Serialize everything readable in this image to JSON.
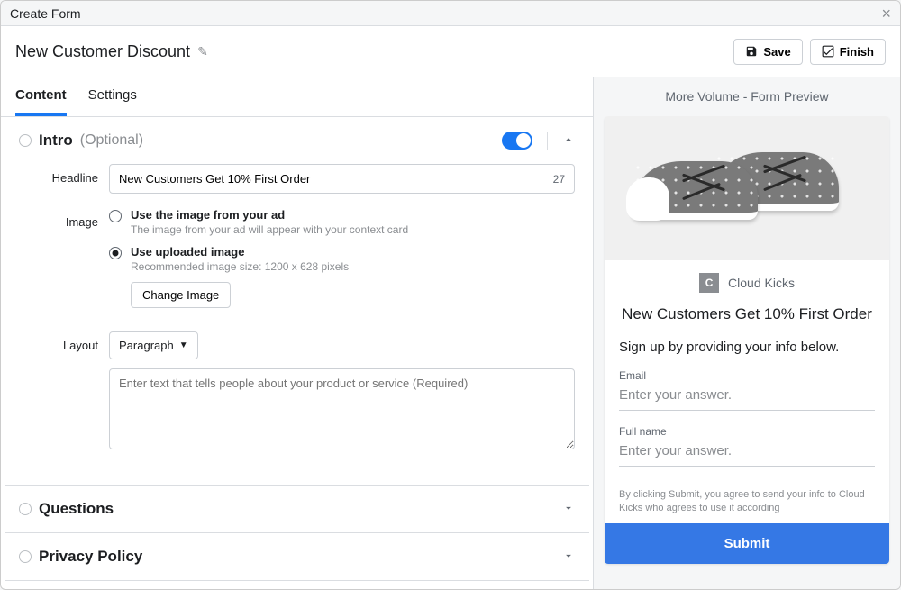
{
  "dialog": {
    "title": "Create Form"
  },
  "form_name": "New Customer Discount",
  "header_buttons": {
    "save": "Save",
    "finish": "Finish"
  },
  "tabs": {
    "content": "Content",
    "settings": "Settings"
  },
  "sections": {
    "intro": {
      "title": "Intro",
      "optional": "(Optional)",
      "toggle_on": true,
      "headline_label": "Headline",
      "headline_value": "New Customers Get 10% First Order",
      "headline_count": "27",
      "image_label": "Image",
      "image_opts": {
        "from_ad": {
          "title": "Use the image from your ad",
          "sub": "The image from your ad will appear with your context card"
        },
        "uploaded": {
          "title": "Use uploaded image",
          "sub": "Recommended image size: 1200 x 628 pixels",
          "button": "Change Image"
        }
      },
      "layout_label": "Layout",
      "layout_value": "Paragraph",
      "textarea_placeholder": "Enter text that tells people about your product or service (Required)"
    },
    "questions": {
      "title": "Questions"
    },
    "privacy": {
      "title": "Privacy Policy"
    }
  },
  "preview": {
    "header": "More Volume - Form Preview",
    "brand_initial": "C",
    "brand_name": "Cloud Kicks",
    "headline": "New Customers Get 10% First Order",
    "subtext": "Sign up by providing your info below.",
    "fields": {
      "email": {
        "label": "Email",
        "placeholder": "Enter your answer."
      },
      "fullname": {
        "label": "Full name",
        "placeholder": "Enter your answer."
      }
    },
    "disclaimer": "By clicking Submit, you agree to send your info to Cloud Kicks who agrees to use it according",
    "submit": "Submit"
  }
}
